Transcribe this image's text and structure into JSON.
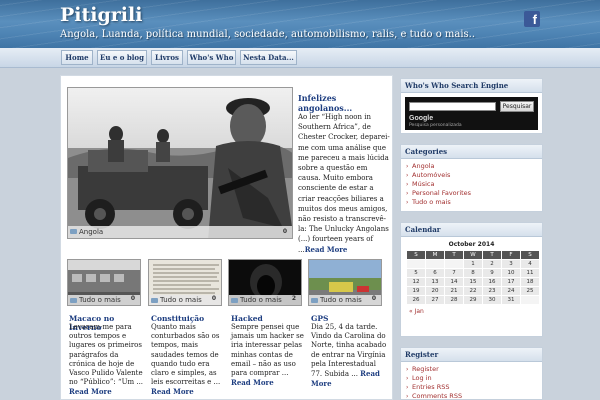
{
  "header": {
    "title": "Pitigrili",
    "description": "Angola, Luanda, política mundial, sociedade, automobilismo, ralis, e tudo o mais..",
    "facebook_label": "f"
  },
  "nav": {
    "items": [
      {
        "label": "Home"
      },
      {
        "label": "Eu e o blog"
      },
      {
        "label": "Livros"
      },
      {
        "label": "Who's Who"
      },
      {
        "label": "Nesta Data..."
      }
    ]
  },
  "featured": {
    "category": "Angola",
    "comments": "0",
    "title": "Infelizes angolanos...",
    "excerpt": "Ao ler “High noon in Southern Africa”, de Chester Crocker, deparei-me com uma análise que me pareceu a mais lúcida sobre a questão em causa. Muito embora consciente de estar a criar reacções biliares a muitos dos meus amigos, não resisto a transcrevê-la: The Unlucky Angolans (...) fourteen years of ...",
    "read_more": "Read More"
  },
  "posts": [
    {
      "category": "Tudo o mais",
      "comments": "0",
      "title": "Macaco no Inverno",
      "excerpt": "Levaram-me para outros tempos e lugares os primeiros parágrafos da crónica de hoje de Vasco Pulido Valente no “Público”: “Um ...",
      "read_more": "Read More"
    },
    {
      "category": "Tudo o mais",
      "comments": "0",
      "title": "Constituição",
      "excerpt": "Quanto mais conturbados são os tempos, mais saudades temos de quando tudo era claro e simples, as leis escorreitas e ...",
      "read_more": "Read More"
    },
    {
      "category": "Tudo o mais",
      "comments": "2",
      "title": "Hacked",
      "excerpt": "Sempre pensei que jamais um hacker se iria interessar pelas minhas contas de email – não as uso para comprar ...",
      "read_more": "Read More"
    },
    {
      "category": "Tudo o mais",
      "comments": "0",
      "title": "GPS",
      "excerpt": "Dia 25, 4 da tarde. Vindo da Carolina do Norte, tinha acabado de entrar na Virgínia pela Interestadual 77. Subida ...",
      "read_more": "Read More"
    }
  ],
  "sidebar": {
    "search": {
      "title": "Who's Who Search Engine",
      "button": "Pesquisar",
      "logo": "Google",
      "caption": "Pesquisa personalizada"
    },
    "categories": {
      "title": "Categories",
      "items": [
        "Angola",
        "Automóveis",
        "Música",
        "Personal Favorites",
        "Tudo o mais"
      ]
    },
    "calendar": {
      "title": "Calendar",
      "caption": "October 2014",
      "weekdays": [
        "S",
        "M",
        "T",
        "W",
        "T",
        "F",
        "S"
      ],
      "weeks": [
        [
          "",
          "",
          "",
          "1",
          "2",
          "3",
          "4"
        ],
        [
          "5",
          "6",
          "7",
          "8",
          "9",
          "10",
          "11"
        ],
        [
          "12",
          "13",
          "14",
          "15",
          "16",
          "17",
          "18"
        ],
        [
          "19",
          "20",
          "21",
          "22",
          "23",
          "24",
          "25"
        ],
        [
          "26",
          "27",
          "28",
          "29",
          "30",
          "31",
          ""
        ]
      ],
      "prev": "« Jan"
    },
    "register": {
      "title": "Register",
      "items": [
        "Register",
        "Log in",
        "Entries RSS",
        "Comments RSS"
      ]
    }
  },
  "colors": {
    "link": "#1d3d80",
    "category": "#a23030",
    "nav_text": "#1f3a66"
  }
}
